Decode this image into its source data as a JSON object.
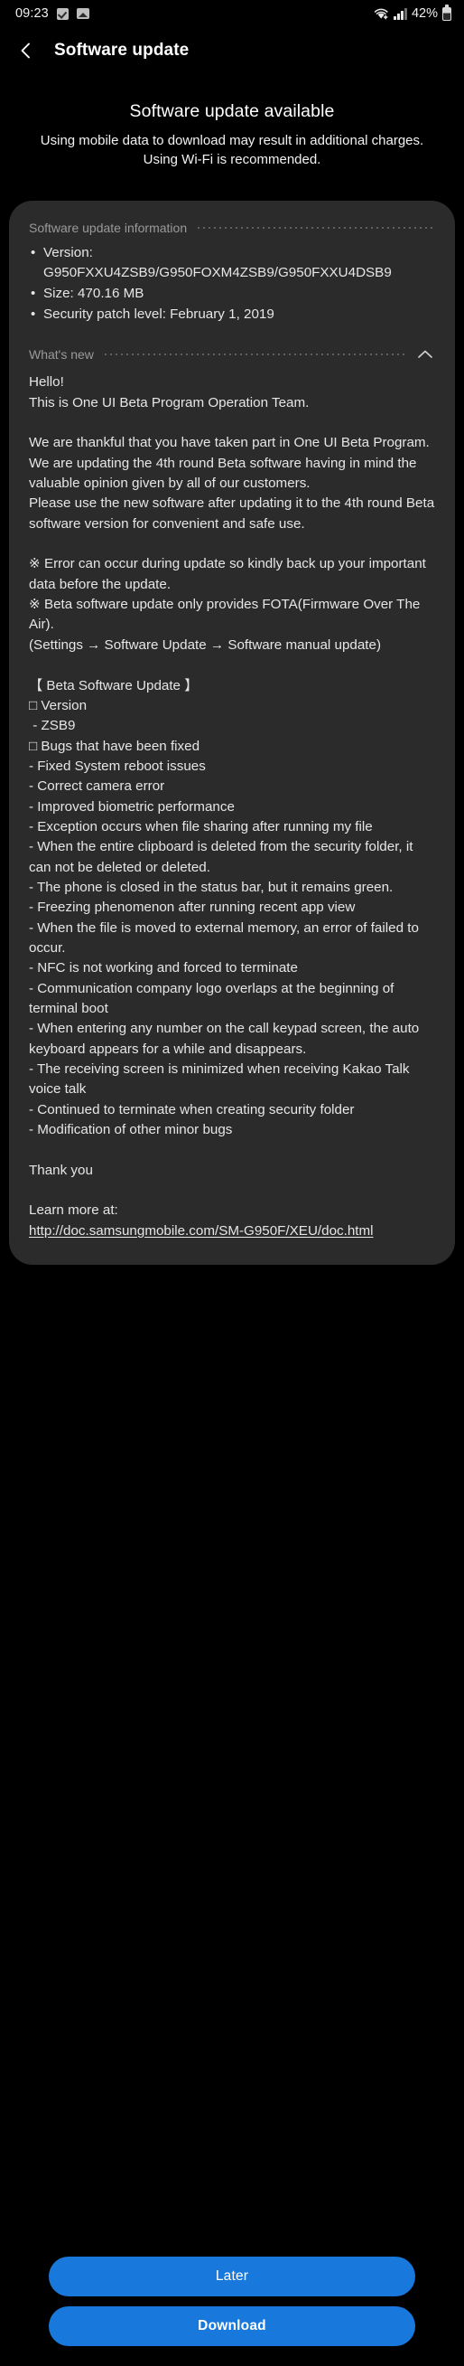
{
  "statusbar": {
    "clock": "09:23",
    "icons_left": [
      "check-badge-icon",
      "photo-icon"
    ],
    "wifi_icon": "wifi-plus-icon",
    "signal_icon": "cellular-signal-icon",
    "battery_percent": "42%",
    "battery_icon": "battery-icon"
  },
  "appbar": {
    "back_icon": "back-arrow-icon",
    "title": "Software update"
  },
  "hero": {
    "title": "Software update available",
    "subtitle": "Using mobile data to download may result in additional charges. Using Wi-Fi is recommended."
  },
  "update_info": {
    "section_label": "Software update information",
    "items": [
      "Version: G950FXXU4ZSB9/G950FOXM4ZSB9/G950FXXU4DSB9",
      "Size: 470.16 MB",
      "Security patch level: February 1, 2019"
    ]
  },
  "whats_new": {
    "section_label": "What's new",
    "collapse_icon": "chevron-up-icon",
    "body": "Hello!\nThis is One UI Beta Program Operation Team.\n\nWe are thankful that you have taken part in One UI Beta Program. We are updating the 4th round Beta software having in mind the valuable opinion given by all of our customers.\nPlease use the new software after updating it to the 4th round Beta software version for convenient and safe use.\n\n※ Error can occur during update so kindly back up your important data before the update.\n※ Beta software update only provides FOTA(Firmware Over The Air).\n(Settings → Software Update → Software manual update)\n\n【 Beta Software Update 】\n□ Version\n - ZSB9\n□ Bugs that have been fixed\n- Fixed System reboot issues\n- Correct camera error\n- Improved biometric performance\n- Exception occurs when file sharing after running my file\n- When the entire clipboard is deleted from the security folder, it can not be deleted or deleted.\n- The phone is closed in the status bar, but it remains green.\n- Freezing phenomenon after running recent app view\n- When the file is moved to external memory, an error of failed to occur.\n- NFC is not working and forced to terminate\n- Communication company logo overlaps at the beginning of terminal boot\n- When entering any number on the call keypad screen, the auto keyboard appears for a while and disappears.\n- The receiving screen is minimized when receiving Kakao Talk voice talk\n- Continued to terminate when creating security folder\n- Modification of other minor bugs\n\nThank you\n\nLearn more at:\n",
    "link_text": "http://doc.samsungmobile.com/SM-G950F/XEU/doc.html"
  },
  "footer": {
    "later_label": "Later",
    "download_label": "Download",
    "accent_color": "#1878dc"
  },
  "theme": {
    "background": "#000000",
    "card_background": "#2b2b2b",
    "primary_text": "#ffffff",
    "secondary_text": "#9a9a9a",
    "body_text": "#e6e6e6"
  }
}
